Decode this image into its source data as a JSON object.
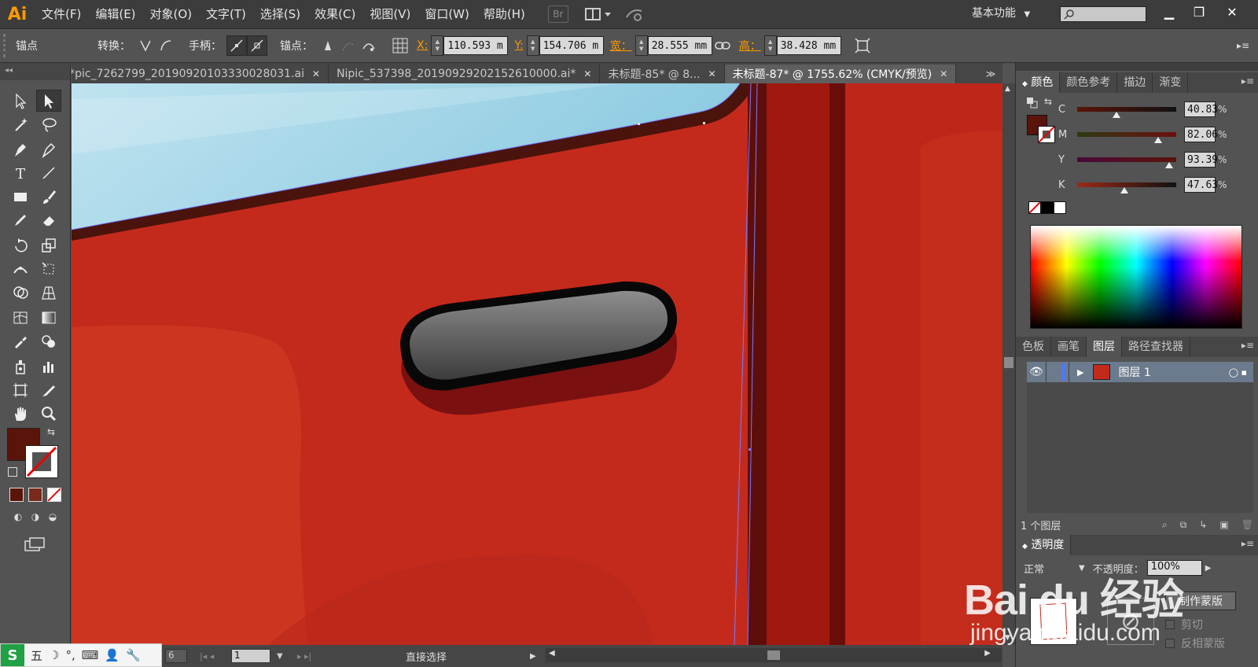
{
  "app": {
    "logo": "Ai",
    "menus": [
      "文件(F)",
      "编辑(E)",
      "对象(O)",
      "文字(T)",
      "选择(S)",
      "效果(C)",
      "视图(V)",
      "窗口(W)",
      "帮助(H)"
    ],
    "bridge": "Br",
    "workspace": "基本功能",
    "search_placeholder": ""
  },
  "control_bar": {
    "mode": "锚点",
    "convert_label": "转换：",
    "handle_label": "手柄：",
    "anchor_label": "锚点：",
    "x_label": "X:",
    "x_value": "110.593 m",
    "y_label": "Y:",
    "y_value": "154.706 m",
    "w_label": "宽：",
    "w_value": "28.555 mm",
    "h_label": "高：",
    "h_value": "38.428 mm"
  },
  "tabs": [
    {
      "label": "pic_7262799_20190920103330028031.ai*",
      "active": false
    },
    {
      "label": "Nipic_537398_20190929202152610000.ai*",
      "active": false
    },
    {
      "label": "未标题-85* @ 8...",
      "active": false
    },
    {
      "label": "未标题-87* @ 1755.62% (CMYK/预览)",
      "active": true
    }
  ],
  "color_panel": {
    "tabs": [
      "颜色",
      "颜色参考",
      "描边",
      "渐变"
    ],
    "sliders": [
      {
        "channel": "C",
        "value": "40.83",
        "pos": 0.4
      },
      {
        "channel": "M",
        "value": "82.06",
        "pos": 0.82
      },
      {
        "channel": "Y",
        "value": "93.39",
        "pos": 0.93
      },
      {
        "channel": "K",
        "value": "47.63",
        "pos": 0.48
      }
    ],
    "pct": "%",
    "fill_color": "#5a1409"
  },
  "layers_panel": {
    "tabs": [
      "色板",
      "画笔",
      "图层",
      "路径查找器"
    ],
    "layer_name": "图层 1",
    "count": "1 个图层"
  },
  "transparency_panel": {
    "title": "透明度",
    "blend_mode": "正常",
    "opacity_label": "不透明度：",
    "opacity_value": "100%",
    "make_mask": "制作蒙版",
    "clip": "剪切",
    "invert_mask": "反相蒙版"
  },
  "status_bar": {
    "zoom": "6",
    "page": "1",
    "tool": "直接选择"
  },
  "ime": {
    "logo": "S",
    "items": [
      "五",
      "☽",
      "°,",
      "⌨",
      "👤",
      "🔧"
    ]
  },
  "watermark": {
    "brand": "Bai du 经验",
    "url": "jingyan.baidu.com"
  }
}
